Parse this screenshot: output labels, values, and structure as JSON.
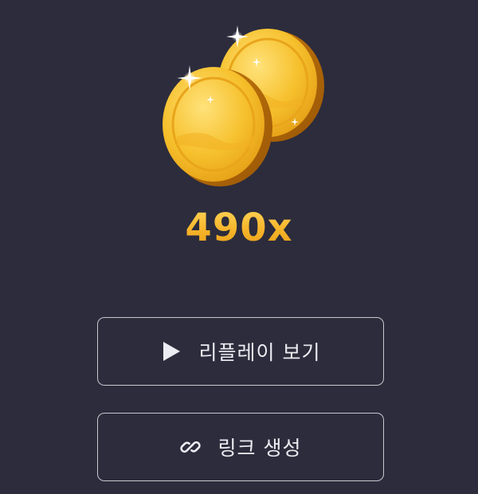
{
  "reward": {
    "multiplier": "490x",
    "icon": "gold-coins"
  },
  "actions": {
    "replay": {
      "label": "리플레이 보기",
      "icon": "play-icon"
    },
    "link": {
      "label": "링크 생성",
      "icon": "link-icon"
    }
  },
  "colors": {
    "background": "#2c2c3c",
    "gold": "#f5b92c",
    "button_border": "#c9c9d1",
    "text": "#ececf2"
  }
}
